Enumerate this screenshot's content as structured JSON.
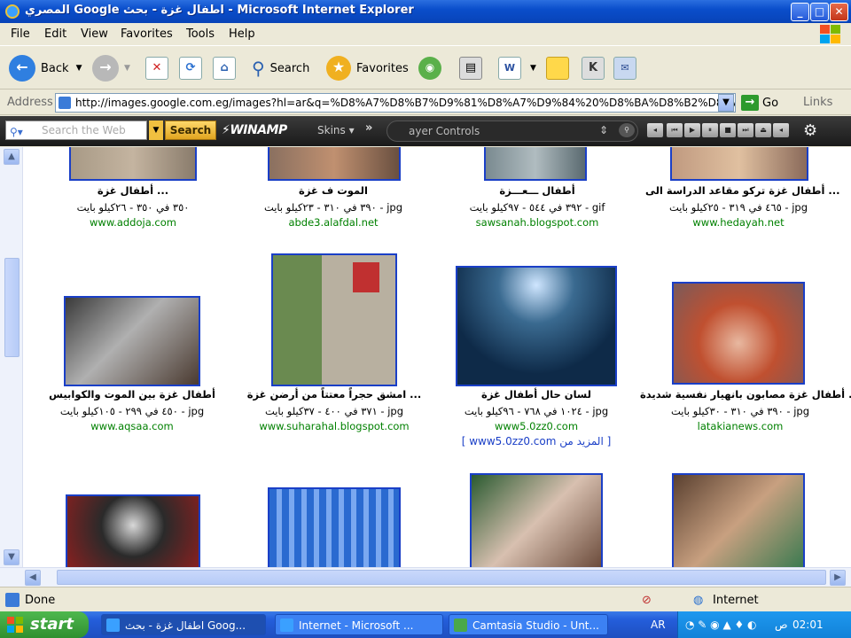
{
  "window": {
    "title": "المصري Google اطفال غزة - بحث - Microsoft Internet Explorer"
  },
  "menu": [
    "File",
    "Edit",
    "View",
    "Favorites",
    "Tools",
    "Help"
  ],
  "toolbar": {
    "back": "Back",
    "search": "Search",
    "favorites": "Favorites"
  },
  "address": {
    "label": "Address",
    "url": "http://images.google.com.eg/images?hl=ar&q=%D8%A7%D8%B7%D9%81%D8%A7%D9%84%20%D8%BA%D8%B2%D8%A9",
    "go": "Go",
    "links": "Links"
  },
  "searchbar": {
    "placeholder": "Search the Web",
    "button": "Search",
    "winamp": "WINAMP",
    "skins": "Skins",
    "player": "ayer Controls"
  },
  "results": [
    [
      {
        "title": "أطفال غزة تركو مقاعد الدراسة الى ...",
        "info": "٤٦٥ في ٣١٩ - ٢٥كيلو بايت - jpg",
        "site": "www.hedayah.net"
      },
      {
        "title": "أطفال ـــعـــزة",
        "info": "٣٩٢ في ٥٤٤ - ٩٧كيلو بايت - gif",
        "site": "sawsanah.blogspot.com"
      },
      {
        "title": "الموت ف غزة",
        "info": "٣٩٠ في ٣١٠ - ٢٣كيلو بايت - jpg",
        "site": "abde3.alafdal.net"
      },
      {
        "title": "أطفال غزة ...",
        "info": "٣٥٠ في ٣٥٠ - ٢٦كيلو بايت",
        "site": "www.addoja.com"
      }
    ],
    [
      {
        "title": "أطفال غزة مصابون بانهيار نفسية شديدة ...",
        "info": "٣٩٠ في ٣١٠ - ٣٠كيلو بايت - jpg",
        "site": "latakianews.com"
      },
      {
        "title": "لسان حال أطفال غزة",
        "info": "١٠٢٤ في ٧٦٨ - ٩٦كيلو بايت - jpg",
        "site": "www5.0zz0.com",
        "more": "[ www5.0zz0.com المزيد من ]"
      },
      {
        "title": "امشق حجراً معتتاً من أرضن غزة ...",
        "info": "٣٧١ في ٤٠٠ - ٣٧كيلو بايت - jpg",
        "site": "www.suharahal.blogspot.com"
      },
      {
        "title": "أطفال غزة بين الموت والكوابيس",
        "info": "٤٥٠ في ٢٩٩ - ١٠٥كيلو بايت - jpg",
        "site": "www.aqsaa.com"
      }
    ]
  ],
  "status": {
    "left": "Done",
    "zone": "Internet"
  },
  "taskbar": {
    "start": "start",
    "tasks": [
      "اطفال غزة - بحث Goog...",
      "Internet - Microsoft ...",
      "Camtasia Studio - Unt..."
    ],
    "lang": "AR",
    "clock": "02:01",
    "ampm": "ص"
  },
  "colors": {
    "link_green": "#008000",
    "thumb_border": "#1a3fc7",
    "xp_blue": "#245edb"
  }
}
